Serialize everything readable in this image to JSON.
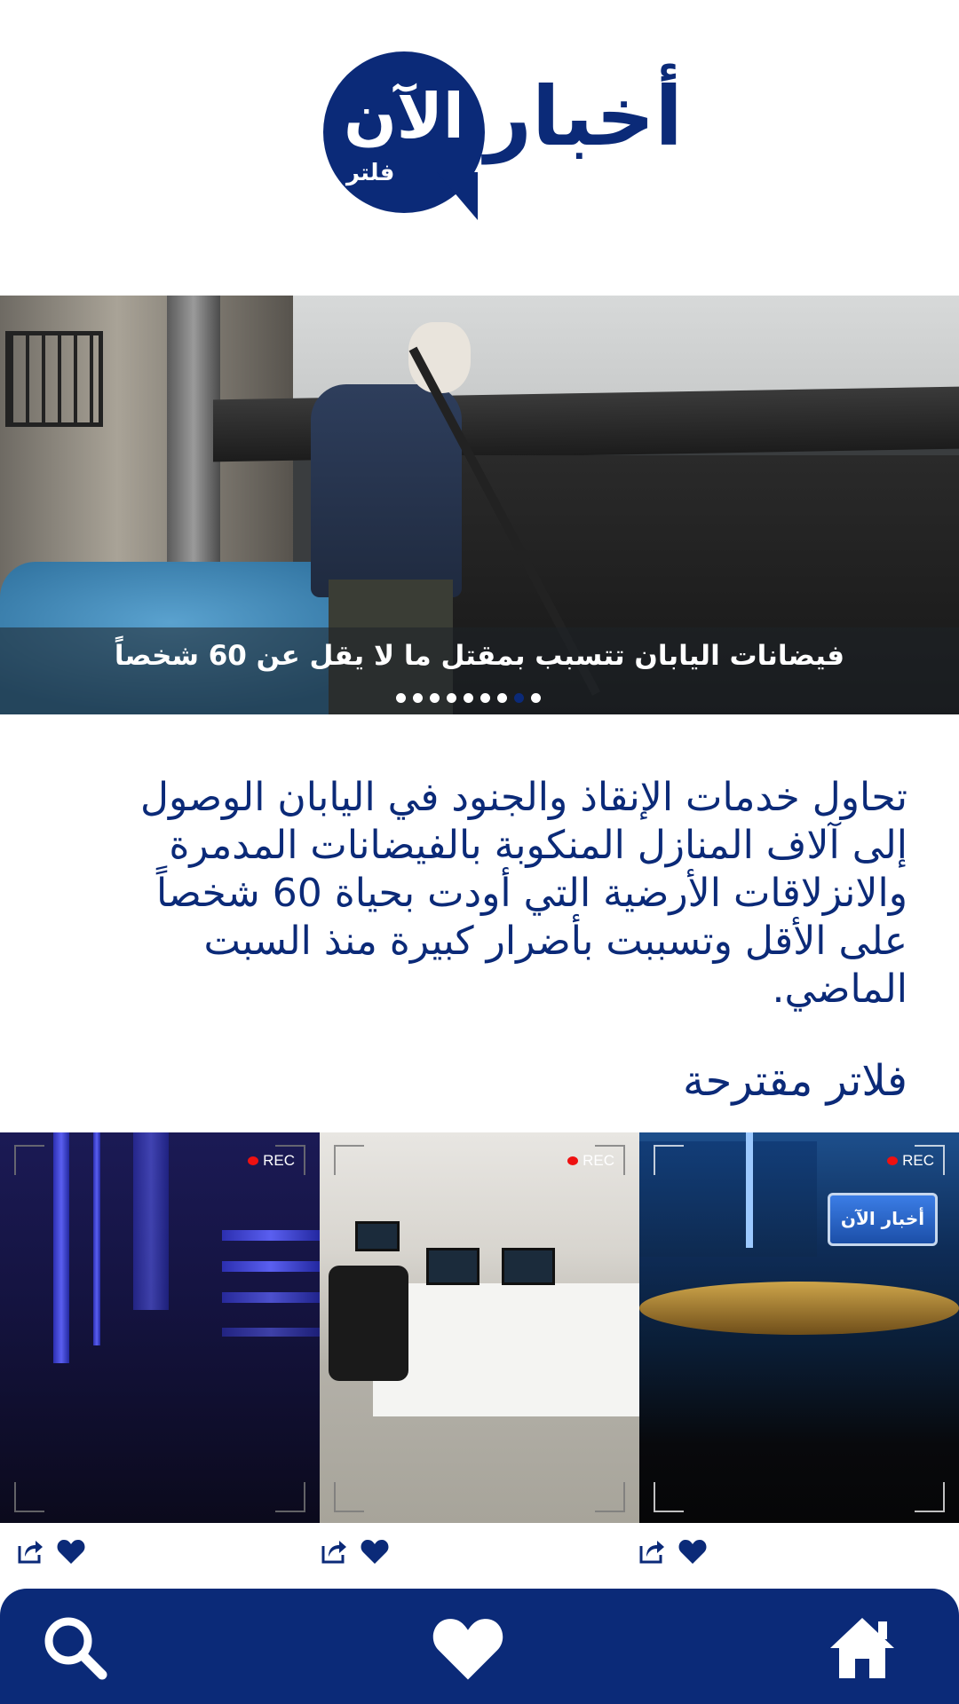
{
  "header": {
    "logo_main": "أخبار",
    "logo_circle_text": "الآن",
    "logo_sub": "فلتر"
  },
  "hero": {
    "caption": "فيضانات اليابان تتسبب بمقتل ما لا يقل عن 60 شخصاً",
    "slide_count": 9,
    "active_slide": 8
  },
  "article": {
    "body": "تحاول خدمات الإنقاذ والجنود في اليابان الوصول إلى آلاف المنازل المنكوبة بالفيضانات المدمرة والانزلاقات الأرضية التي أودت بحياة 60 شخصاً على الأقل وتسببت بأضرار كبيرة منذ السبت الماضي."
  },
  "suggested": {
    "title": "فلاتر مقترحة",
    "rec_label": "REC",
    "studio_screen_text": "أخبار الآن"
  },
  "colors": {
    "brand": "#0b2a78",
    "rec": "#ee1111"
  },
  "icons": {
    "share": "share-icon",
    "like": "heart-icon",
    "nav": [
      "search-icon",
      "heart-icon",
      "home-icon"
    ]
  }
}
